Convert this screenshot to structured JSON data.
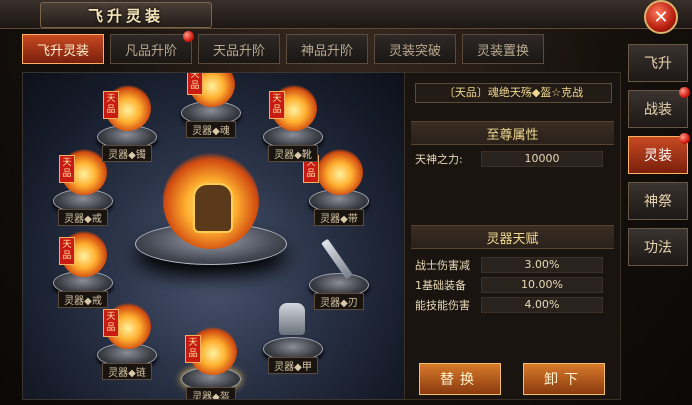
{
  "window": {
    "title": "飞升灵装"
  },
  "tabs": [
    {
      "label": "飞升灵装",
      "active": true
    },
    {
      "label": "凡品升阶",
      "active": false,
      "dot": true
    },
    {
      "label": "天品升阶",
      "active": false
    },
    {
      "label": "神品升阶",
      "active": false
    },
    {
      "label": "灵装突破",
      "active": false
    },
    {
      "label": "灵装置换",
      "active": false
    }
  ],
  "side_menu": [
    {
      "label": "飞升"
    },
    {
      "label": "战装",
      "dot": true
    },
    {
      "label": "灵装",
      "active": true,
      "dot": true
    },
    {
      "label": "神祭"
    },
    {
      "label": "功法"
    }
  ],
  "slots": [
    {
      "label": "灵器◆镯",
      "tag": "天品"
    },
    {
      "label": "灵器◆魂",
      "tag": "天品"
    },
    {
      "label": "灵器◆靴",
      "tag": "天品"
    },
    {
      "label": "灵器◆戒",
      "tag": "天品"
    },
    {
      "label": "灵器◆带",
      "tag": "天品"
    },
    {
      "label": "灵器◆戒",
      "tag": "天品"
    },
    {
      "label": "灵器◆刃"
    },
    {
      "label": "灵器◆链",
      "tag": "天品"
    },
    {
      "label": "灵器◆甲"
    },
    {
      "label": "灵器◆盔",
      "tag": "天品"
    }
  ],
  "detail": {
    "item_name": "〔天品〕魂绝天殇◆盔☆克战",
    "supreme_header": "至尊属性",
    "supreme_key": "天神之力:",
    "supreme_value": "10000",
    "talent_header": "灵器天赋",
    "talents": [
      {
        "key": "战士伤害减",
        "value": "3.00%"
      },
      {
        "key": "1基础装备",
        "value": "10.00%"
      },
      {
        "key": "能技能伤害",
        "value": "4.00%"
      }
    ]
  },
  "buttons": {
    "replace": "替换",
    "unequip": "卸下"
  },
  "icons": {
    "close": "close-icon"
  },
  "colors": {
    "accent": "#c84a22",
    "gold": "#f0d890"
  }
}
